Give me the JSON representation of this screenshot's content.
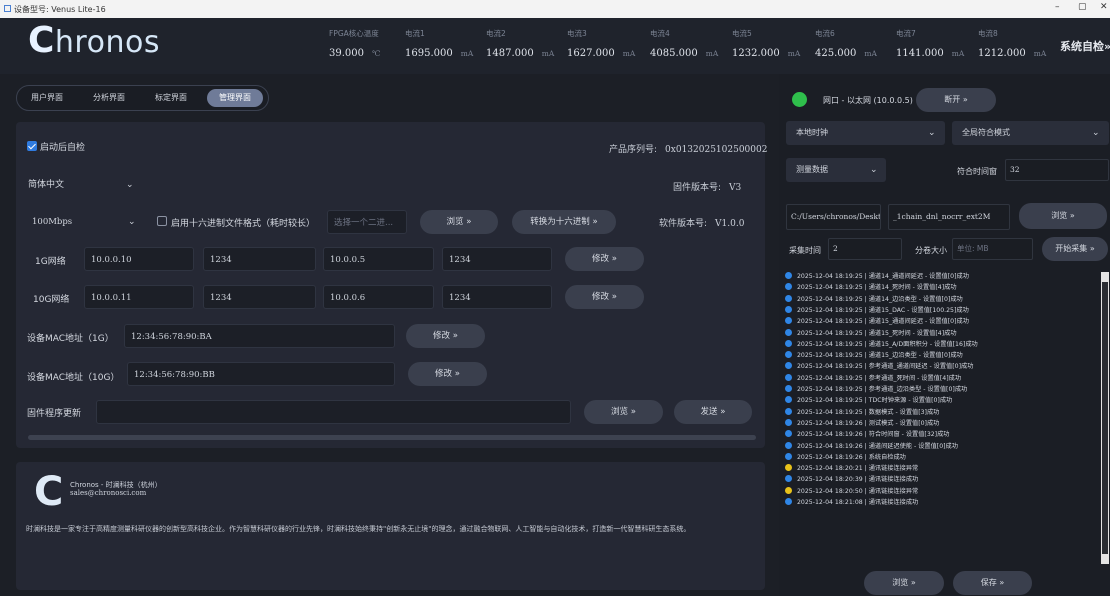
{
  "window": {
    "title": "设备型号: Venus Lite-16",
    "min": "–",
    "max": "▢",
    "close": "✕"
  },
  "header": {
    "logo": "hronos",
    "logo_c": "C",
    "metrics": [
      {
        "label": "FPGA核心温度",
        "value": "39.000",
        "unit": "℃"
      },
      {
        "label": "电流1",
        "value": "1695.000",
        "unit": "mA"
      },
      {
        "label": "电流2",
        "value": "1487.000",
        "unit": "mA"
      },
      {
        "label": "电流3",
        "value": "1627.000",
        "unit": "mA"
      },
      {
        "label": "电流4",
        "value": "4085.000",
        "unit": "mA"
      },
      {
        "label": "电流5",
        "value": "1232.000",
        "unit": "mA"
      },
      {
        "label": "电流6",
        "value": "425.000",
        "unit": "mA"
      },
      {
        "label": "电流7",
        "value": "1141.000",
        "unit": "mA"
      },
      {
        "label": "电流8",
        "value": "1212.000",
        "unit": "mA"
      }
    ],
    "selfcheck": "系统自检»"
  },
  "tabs": [
    "用户界面",
    "分析界面",
    "标定界面",
    "管理界面"
  ],
  "admin": {
    "autocheck_label": "启动后自检",
    "product_sn_label": "产品序列号:",
    "product_sn": "0x0132025102500002",
    "language": "简体中文",
    "fw_version_label": "固件版本号:",
    "fw_version": "V3",
    "speed": "100Mbps",
    "hex_label": "启用十六进制文件格式（耗时较长）",
    "hex_file_placeholder": "选择一个二进...",
    "browse": "浏览 »",
    "convert": "转换为十六进制 »",
    "sw_version_label": "软件版本号:",
    "sw_version": "V1.0.0",
    "net1g_label": "1G网络",
    "net1g": [
      "10.0.0.10",
      "1234",
      "10.0.0.5",
      "1234"
    ],
    "net10g_label": "10G网络",
    "net10g": [
      "10.0.0.11",
      "1234",
      "10.0.0.6",
      "1234"
    ],
    "modify": "修改 »",
    "mac1g_label": "设备MAC地址（1G）",
    "mac1g": "12:34:56:78:90:BA",
    "mac10g_label": "设备MAC地址（10G）",
    "mac10g": "12:34:56:78:90:BB",
    "fw_update_label": "固件程序更新",
    "send": "发送 »"
  },
  "about": {
    "company": "Chronos - 时澜科技（杭州）",
    "email": "sales@chronosci.com",
    "description": "时澜科技是一家专注于高精度测量科研仪器的创新型高科技企业。作为智慧科研仪器的行业先锋，时澜科技始终秉持\"创新永无止境\"的理念，通过融合物联网、人工智能与自动化技术，打造新一代智慧科研生态系统。"
  },
  "right": {
    "connection": "网口 - 以太网 (10.0.0.5)",
    "disconnect": "断开 »",
    "clock": "本地时钟",
    "coincidence_mode": "全局符合模式",
    "measure": "测量数据",
    "coinc_window_label": "符合时间窗",
    "coinc_window": "32",
    "path": "C:/Users/chronos/Desktop",
    "filename": "_1chain_dnl_nocrr_ext2M",
    "browse": "浏览 »",
    "acq_time_label": "采集时间",
    "acq_time": "2",
    "split_label": "分卷大小",
    "split_placeholder": "单位: MB",
    "start": "开始采集 »",
    "logs": [
      {
        "text": "2025-12-04 18:19:25 | 通道14_通道间延迟 - 设置值[0]成功",
        "level": "info"
      },
      {
        "text": "2025-12-04 18:19:25 | 通道14_死时间 - 设置值[4]成功",
        "level": "info"
      },
      {
        "text": "2025-12-04 18:19:25 | 通道14_边沿类型 - 设置值[0]成功",
        "level": "info"
      },
      {
        "text": "2025-12-04 18:19:25 | 通道15_DAC - 设置值[100.25]成功",
        "level": "info"
      },
      {
        "text": "2025-12-04 18:19:25 | 通道15_通道间延迟 - 设置值[0]成功",
        "level": "info"
      },
      {
        "text": "2025-12-04 18:19:25 | 通道15_死时间 - 设置值[4]成功",
        "level": "info"
      },
      {
        "text": "2025-12-04 18:19:25 | 通道15_A/D面积积分 - 设置值[16]成功",
        "level": "info"
      },
      {
        "text": "2025-12-04 18:19:25 | 通道15_边沿类型 - 设置值[0]成功",
        "level": "info"
      },
      {
        "text": "2025-12-04 18:19:25 | 参考通道_通道间延迟 - 设置值[0]成功",
        "level": "info"
      },
      {
        "text": "2025-12-04 18:19:25 | 参考通道_死时间 - 设置值[4]成功",
        "level": "info"
      },
      {
        "text": "2025-12-04 18:19:25 | 参考通道_边沿类型 - 设置值[0]成功",
        "level": "info"
      },
      {
        "text": "2025-12-04 18:19:25 | TDC时钟来源 - 设置值[0]成功",
        "level": "info"
      },
      {
        "text": "2025-12-04 18:19:25 | 数据模式 - 设置值[3]成功",
        "level": "info"
      },
      {
        "text": "2025-12-04 18:19:26 | 测试模式 - 设置值[0]成功",
        "level": "info"
      },
      {
        "text": "2025-12-04 18:19:26 | 符合时间窗 - 设置值[32]成功",
        "level": "info"
      },
      {
        "text": "2025-12-04 18:19:26 | 通道间延迟使能 - 设置值[0]成功",
        "level": "info"
      },
      {
        "text": "2025-12-04 18:19:26 | 系统自检成功",
        "level": "info"
      },
      {
        "text": "2025-12-04 18:20:21 | 通讯链接连接异常",
        "level": "warn"
      },
      {
        "text": "2025-12-04 18:20:39 | 通讯链接连接成功",
        "level": "info"
      },
      {
        "text": "2025-12-04 18:20:50 | 通讯链接连接异常",
        "level": "warn"
      },
      {
        "text": "2025-12-04 18:21:08 | 通讯链接连接成功",
        "level": "info"
      }
    ],
    "browse_bottom": "浏览 »",
    "save": "保存 »"
  },
  "colors": {
    "info": "#2f86e6",
    "warn": "#e8c21a",
    "connected": "#2fbf4c"
  }
}
